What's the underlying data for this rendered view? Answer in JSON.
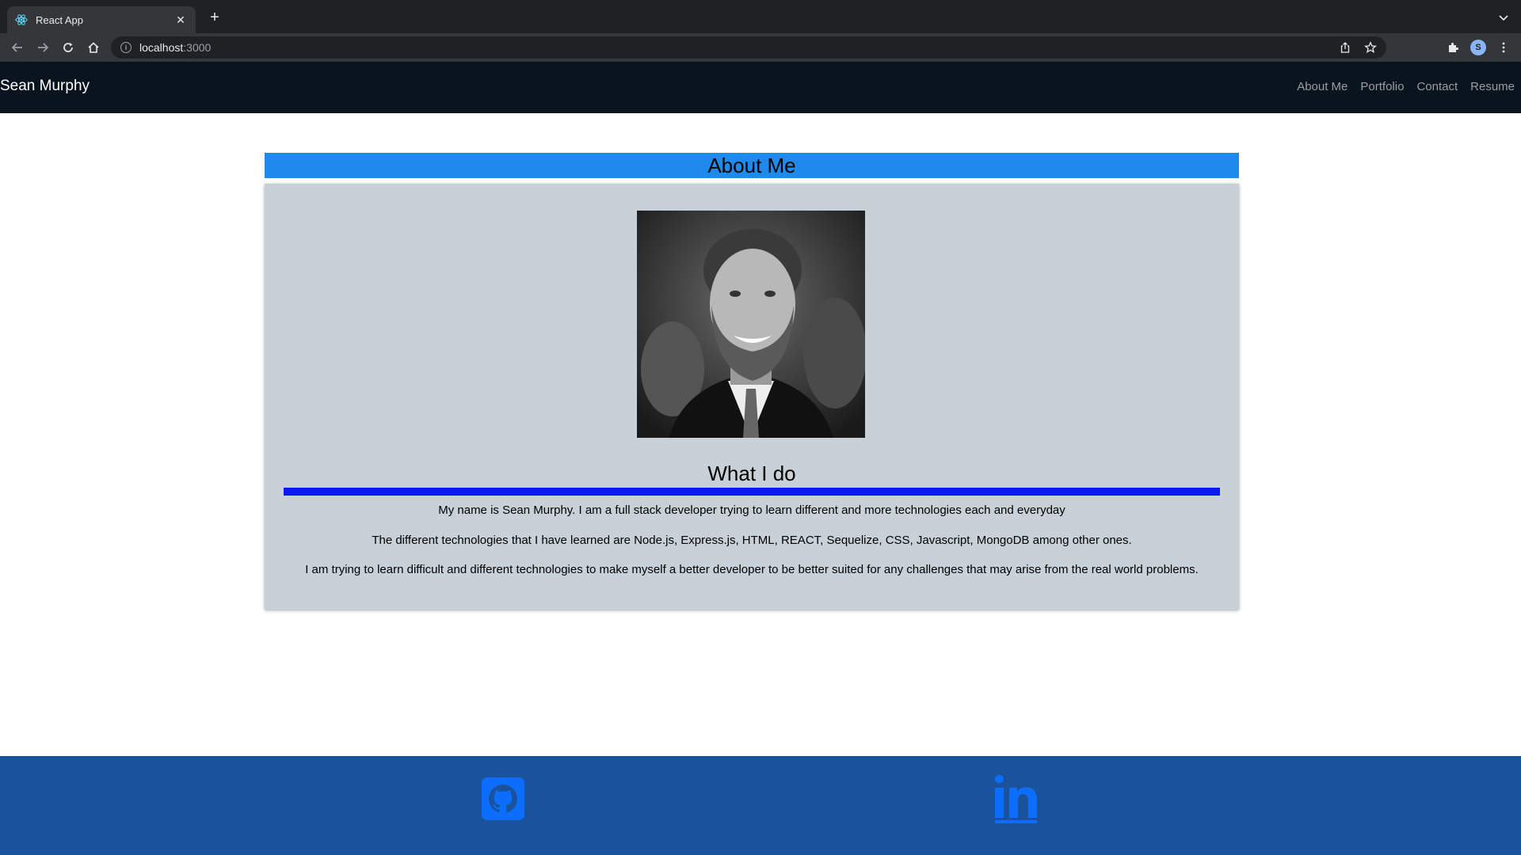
{
  "browser": {
    "tab_title": "React App",
    "url_host": "localhost",
    "url_port": ":3000",
    "profile_initial": "S"
  },
  "navbar": {
    "brand": "Sean Murphy",
    "links": [
      "About Me",
      "Portfolio",
      "Contact",
      "Resume"
    ]
  },
  "about": {
    "title": "About Me",
    "photo_alt": "Black and white portrait photo",
    "subtitle": "What I do",
    "paragraphs": [
      "My name is Sean Murphy. I am a full stack developer trying to learn different and more technologies each and everyday",
      "The different technologies that I have learned are Node.js, Express.js, HTML, REACT, Sequelize, CSS, Javascript, MongoDB among other ones.",
      "I am trying to learn difficult and different technologies to make myself a better developer to be better suited for any challenges that may arise from the real world problems."
    ]
  },
  "footer": {
    "icons": [
      "github-icon",
      "linkedin-icon"
    ],
    "icon_color": "#0d6efd"
  },
  "colors": {
    "navbar_bg": "#0a141e",
    "header_bg": "#1e8aeb",
    "card_bg": "#c9d1d8",
    "divider": "#0a1bf0",
    "footer_bg": "#1a539c"
  }
}
